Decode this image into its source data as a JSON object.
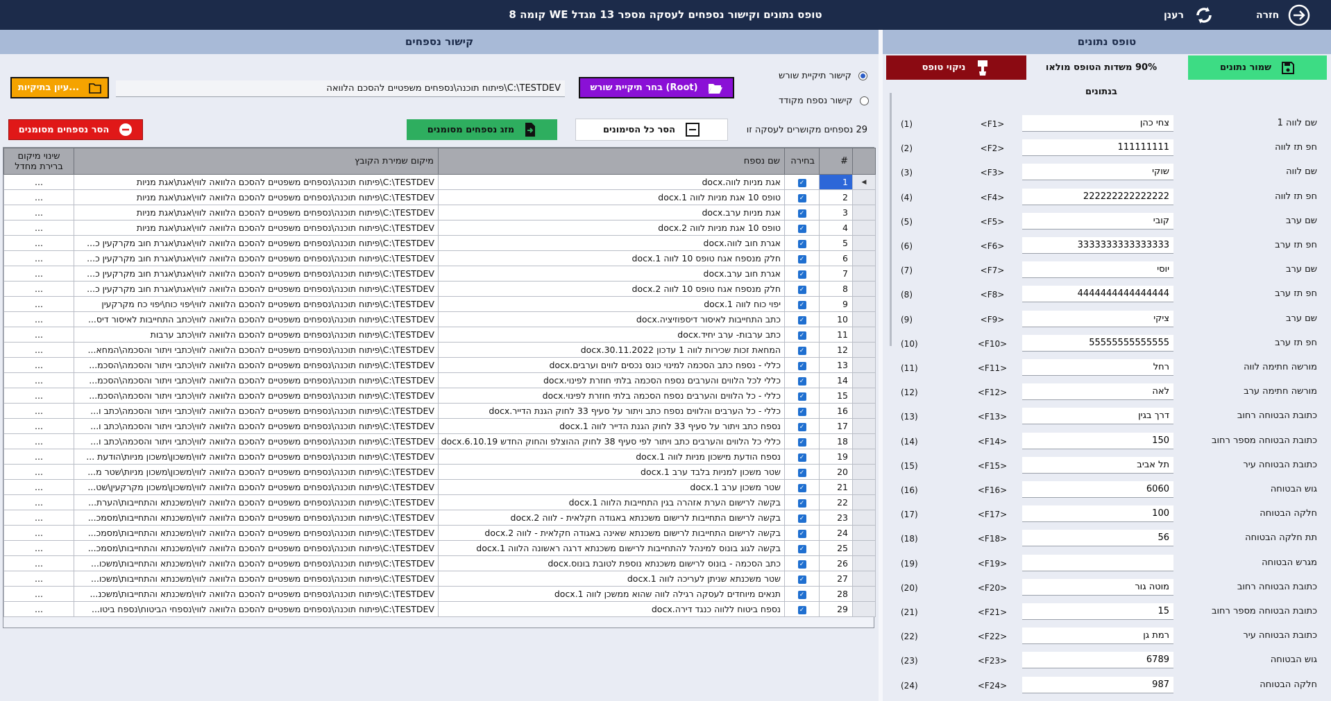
{
  "window": {
    "title": "טופס נתונים וקישור נספחים לעסקה מספר 13 מגדל WE קומה 8",
    "back_label": "חזרה",
    "refresh_label": "רענן"
  },
  "left_panel": {
    "header": "קישור נספחים",
    "radio_root": "קישור תיקיית שורש",
    "radio_specific": "קישור נספח מקודד",
    "choose_root_label": "בחר תיקיית שורש (Root)",
    "root_path": "C:\\TESTDEV\\פיתוח תוכנה\\נספחים משפטיים להסכם הלוואה",
    "browse_label": "עיון בתיקיות...",
    "count_text": "29 נספחים מקושרים לעסקה זו",
    "clear_marks_label": "הסר כל הסימונים",
    "merge_label": "מזג נספחים מסומנים",
    "remove_label": "הסר נספחים מסומנים"
  },
  "table": {
    "columns": [
      "#",
      "בחירה",
      "שם נספח",
      "מיקום שמירת הקובץ",
      "שינוי מיקום ברירת מחדל"
    ],
    "rows": [
      {
        "n": "1",
        "name": "אגת מניות לווה.docx",
        "path": "C:\\TESTDEV\\פיתוח תוכנה\\נספחים משפטיים להסכם הלוואה לווי\\אגת\\אגת מניות"
      },
      {
        "n": "2",
        "name": "טופס 10 אגת מניות לווה 1.docx",
        "path": "C:\\TESTDEV\\פיתוח תוכנה\\נספחים משפטיים להסכם הלוואה לווי\\אגת\\אגת מניות"
      },
      {
        "n": "3",
        "name": "אגת מניות ערב.docx",
        "path": "C:\\TESTDEV\\פיתוח תוכנה\\נספחים משפטיים להסכם הלוואה לווי\\אגת\\אגת מניות"
      },
      {
        "n": "4",
        "name": "טופס 10 אגת מניות לווה 2.docx",
        "path": "C:\\TESTDEV\\פיתוח תוכנה\\נספחים משפטיים להסכם הלוואה לווי\\אגת\\אגת מניות"
      },
      {
        "n": "5",
        "name": "אגרת חוב לווה.docx",
        "path": "C:\\TESTDEV\\פיתוח תוכנה\\נספחים משפטיים להסכם הלוואה לווי\\אגת\\אגרת חוב מקרקעין כ..."
      },
      {
        "n": "6",
        "name": "חלק מנספח אגח טופס 10 לווה 1.docx",
        "path": "C:\\TESTDEV\\פיתוח תוכנה\\נספחים משפטיים להסכם הלוואה לווי\\אגת\\אגרת חוב מקרקעין כ..."
      },
      {
        "n": "7",
        "name": "אגרת חוב ערב.docx",
        "path": "C:\\TESTDEV\\פיתוח תוכנה\\נספחים משפטיים להסכם הלוואה לווי\\אגת\\אגרת חוב מקרקעין כ..."
      },
      {
        "n": "8",
        "name": "חלק מנספח אגח טופס 10 לווה 2.docx",
        "path": "C:\\TESTDEV\\פיתוח תוכנה\\נספחים משפטיים להסכם הלוואה לווי\\אגת\\אגרת חוב מקרקעין כ..."
      },
      {
        "n": "9",
        "name": "יפוי כוח לווה 1.docx",
        "path": "C:\\TESTDEV\\פיתוח תוכנה\\נספחים משפטיים להסכם הלוואה לווי\\יפוי כוח\\יפוי כח מקרקעין"
      },
      {
        "n": "10",
        "name": "כתב התחייבות לאיסור דיספוזיציה.docx",
        "path": "C:\\TESTDEV\\פיתוח תוכנה\\נספחים משפטיים להסכם הלוואה לווי\\כתב התחייבות לאיסור דיס..."
      },
      {
        "n": "11",
        "name": "כתב ערבות- ערב יחיד.docx",
        "path": "C:\\TESTDEV\\פיתוח תוכנה\\נספחים משפטיים להסכם הלוואה לווי\\כתב ערבות"
      },
      {
        "n": "12",
        "name": "המחאת זכות שכירות לווה 1 עדכון 30.11.2022.docx",
        "path": "C:\\TESTDEV\\פיתוח תוכנה\\נספחים משפטיים להסכם הלוואה לווי\\כתבי ויתור והסכמה\\המחא..."
      },
      {
        "n": "13",
        "name": "כללי - נספח כתב הסכמה למינוי כונס נכסים לווים וערבים.docx",
        "path": "C:\\TESTDEV\\פיתוח תוכנה\\נספחים משפטיים להסכם הלוואה לווי\\כתבי ויתור והסכמה\\הסכמ..."
      },
      {
        "n": "14",
        "name": "כללי לכל הלווים והערבים נספח הסכמה בלתי חוזרת לפינוי.docx",
        "path": "C:\\TESTDEV\\פיתוח תוכנה\\נספחים משפטיים להסכם הלוואה לווי\\כתבי ויתור והסכמה\\הסכמ..."
      },
      {
        "n": "15",
        "name": "כללי - כל הלווים והערבים נספח הסכמה בלתי חוזרת לפינוי.docx",
        "path": "C:\\TESTDEV\\פיתוח תוכנה\\נספחים משפטיים להסכם הלוואה לווי\\כתבי ויתור והסכמה\\הסכמ..."
      },
      {
        "n": "16",
        "name": "כללי - כל הערבים והלווים נספח כתב ויתור על סעיף 33 לחוק הגנת הדייר.docx",
        "path": "C:\\TESTDEV\\פיתוח תוכנה\\נספחים משפטיים להסכם הלוואה לווי\\כתבי ויתור והסכמה\\כתב ו..."
      },
      {
        "n": "17",
        "name": "נספח כתב ויתור על סעיף 33 לחוק הגנת הדייר לווה 1.docx",
        "path": "C:\\TESTDEV\\פיתוח תוכנה\\נספחים משפטיים להסכם הלוואה לווי\\כתבי ויתור והסכמה\\כתב ו..."
      },
      {
        "n": "18",
        "name": "כללי כל הלווים והערבים כתב ויתור לפי סעיף 38 לחוק ההוצלפ והחוק החדש 6.10.19.docx",
        "path": "C:\\TESTDEV\\פיתוח תוכנה\\נספחים משפטיים להסכם הלוואה לווי\\כתבי ויתור והסכמה\\כתב ו..."
      },
      {
        "n": "19",
        "name": "נספח הודעת מישכון מניות לווה 1.docx",
        "path": "C:\\TESTDEV\\פיתוח תוכנה\\נספחים משפטיים להסכם הלוואה לווי\\משכון\\משכון מניות\\הודעת ..."
      },
      {
        "n": "20",
        "name": "שטר משכון למניות בלבד ערב 1.docx",
        "path": "C:\\TESTDEV\\פיתוח תוכנה\\נספחים משפטיים להסכם הלוואה לווי\\משכון\\משכון מניות\\שטר מ..."
      },
      {
        "n": "21",
        "name": "שטר משכון ערב 1.docx",
        "path": "C:\\TESTDEV\\פיתוח תוכנה\\נספחים משפטיים להסכם הלוואה לווי\\משכון\\משכון מקרקעין\\שט..."
      },
      {
        "n": "22",
        "name": "בקשה לרישום הערת אזהרה בגין התחייבות הלווה 1.docx",
        "path": "C:\\TESTDEV\\פיתוח תוכנה\\נספחים משפטיים להסכם הלוואה לווי\\משכנתא והתחייבות\\הערת..."
      },
      {
        "n": "23",
        "name": "בקשה לרישום התחייבות לרישום משכנתא באגודה חקלאית - לווה 2.docx",
        "path": "C:\\TESTDEV\\פיתוח תוכנה\\נספחים משפטיים להסכם הלוואה לווי\\משכנתא והתחייבות\\מסמכ..."
      },
      {
        "n": "24",
        "name": "בקשה לרישום התחייבות לרישום משכנתא שאינה באגודה חקלאית - לווה 2.docx",
        "path": "C:\\TESTDEV\\פיתוח תוכנה\\נספחים משפטיים להסכם הלוואה לווי\\משכנתא והתחייבות\\מסמכ..."
      },
      {
        "n": "25",
        "name": "בקשה לגוג בונוס למינהל להתחייבות לרישום משכנתא דרגה ראשונה הלווה 1.docx",
        "path": "C:\\TESTDEV\\פיתוח תוכנה\\נספחים משפטיים להסכם הלוואה לווי\\משכנתא והתחייבות\\מסמכ..."
      },
      {
        "n": "26",
        "name": "כתב הסכמה - בונוס לרישום משכנתא נוספת לטובת בונוס.docx",
        "path": "C:\\TESTDEV\\פיתוח תוכנה\\נספחים משפטיים להסכם הלוואה לווי\\משכנתא והתחייבות\\משכו..."
      },
      {
        "n": "27",
        "name": "שטר משכנתא שניתן לעריכה לווה 1.docx",
        "path": "C:\\TESTDEV\\פיתוח תוכנה\\נספחים משפטיים להסכם הלוואה לווי\\משכנתא והתחייבות\\משכו..."
      },
      {
        "n": "28",
        "name": "תנאים מיוחדים לעסקה רגילה לווה שהוא ממשכן לווה 1.docx",
        "path": "C:\\TESTDEV\\פיתוח תוכנה\\נספחים משפטיים להסכם הלוואה לווי\\משכנתא והתחייבות\\משכנ..."
      },
      {
        "n": "29",
        "name": "נספח ביטוח ללווה כנגד דירה.docx",
        "path": "C:\\TESTDEV\\פיתוח תוכנה\\נספחים משפטיים להסכם הלוואה לווי\\נספחי הביטוח\\נספח ביטו..."
      }
    ],
    "more_label": "..."
  },
  "right_panel": {
    "header": "טופס נתונים",
    "save_label": "שמור נתונים",
    "progress_text": "90% משדות הטופס מולאו בנתונים",
    "progress_value": 0.9,
    "clear_label": "ניקוי טופס",
    "fields": [
      {
        "idx": "(1)",
        "key": "<F1>",
        "label": "שם לווה 1",
        "value": "צחי כהן"
      },
      {
        "idx": "(2)",
        "key": "<F2>",
        "label": "חפ תז לווה",
        "value": "111111111"
      },
      {
        "idx": "(3)",
        "key": "<F3>",
        "label": "שם לווה",
        "value": "שוקי"
      },
      {
        "idx": "(4)",
        "key": "<F4>",
        "label": "חפ תז לווה",
        "value": "222222222222222"
      },
      {
        "idx": "(5)",
        "key": "<F5>",
        "label": "שם ערב",
        "value": "קובי"
      },
      {
        "idx": "(6)",
        "key": "<F6>",
        "label": "חפ תז ערב",
        "value": "3333333333333333"
      },
      {
        "idx": "(7)",
        "key": "<F7>",
        "label": "שם ערב",
        "value": "יוסי"
      },
      {
        "idx": "(8)",
        "key": "<F8>",
        "label": "חפ תז ערב",
        "value": "4444444444444444"
      },
      {
        "idx": "(9)",
        "key": "<F9>",
        "label": "שם ערב",
        "value": "ציקי"
      },
      {
        "idx": "(10)",
        "key": "<F10>",
        "label": "חפ תז ערב",
        "value": "55555555555555"
      },
      {
        "idx": "(11)",
        "key": "<F11>",
        "label": "מורשה חתימה לווה",
        "value": "רחל"
      },
      {
        "idx": "(12)",
        "key": "<F12>",
        "label": "מורשה חתימה ערב",
        "value": "לאה"
      },
      {
        "idx": "(13)",
        "key": "<F13>",
        "label": "כתובת הבטוחה רחוב",
        "value": "דרך בגין"
      },
      {
        "idx": "(14)",
        "key": "<F14>",
        "label": "כתובת הבטוחה מספר רחוב",
        "value": "150"
      },
      {
        "idx": "(15)",
        "key": "<F15>",
        "label": "כתובת הבטוחה עיר",
        "value": "תל אביב"
      },
      {
        "idx": "(16)",
        "key": "<F16>",
        "label": "גוש הבטוחה",
        "value": "6060"
      },
      {
        "idx": "(17)",
        "key": "<F17>",
        "label": "חלקה הבטוחה",
        "value": "100"
      },
      {
        "idx": "(18)",
        "key": "<F18>",
        "label": "תת חלקה הבטוחה",
        "value": "56"
      },
      {
        "idx": "(19)",
        "key": "<F19>",
        "label": "מגרש הבטוחה",
        "value": ""
      },
      {
        "idx": "(20)",
        "key": "<F20>",
        "label": "כתובת הבטוחה רחוב",
        "value": "מוטה גור"
      },
      {
        "idx": "(21)",
        "key": "<F21>",
        "label": "כתובת הבטוחה מספר רחוב",
        "value": "15"
      },
      {
        "idx": "(22)",
        "key": "<F22>",
        "label": "כתובת הבטוחה עיר",
        "value": "רמת גן"
      },
      {
        "idx": "(23)",
        "key": "<F23>",
        "label": "גוש הבטוחה",
        "value": "6789"
      },
      {
        "idx": "(24)",
        "key": "<F24>",
        "label": "חלקה הבטוחה",
        "value": "987"
      }
    ]
  },
  "colors": {
    "topbar": "#1c2b4a",
    "header": "#a8bad7",
    "save": "#3ddc84",
    "clear": "#8b0a12",
    "choose_root": "#8a10d6",
    "browse": "#f5a300",
    "merge": "#2eae5f",
    "remove": "#e01818",
    "selected_row": "#2d67d8"
  }
}
